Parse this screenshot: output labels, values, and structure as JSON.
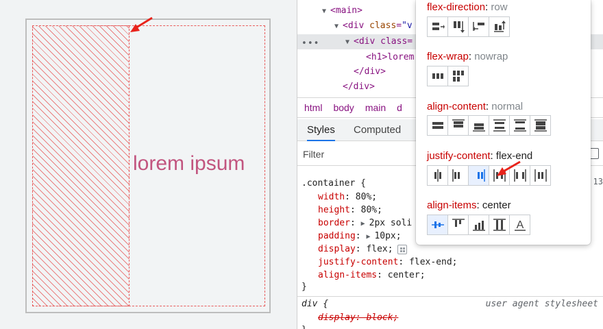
{
  "preview": {
    "h1_text": "lorem ipsum"
  },
  "devtools": {
    "dom_tree": {
      "main_tag": "main",
      "div_tag": "div",
      "div_class_attr": "class",
      "div_class_value_partial": "\"v",
      "selected_div_partial": "div class=",
      "h1_text": "h1>lorem",
      "close_div_1": "/div>",
      "close_div_2": "/div>"
    },
    "breadcrumbs": [
      "html",
      "body",
      "main",
      "d"
    ],
    "tabs": {
      "styles": "Styles",
      "computed": "Computed"
    },
    "filter": {
      "placeholder": "Filter"
    },
    "rules": {
      "container_selector": ".container {",
      "decls": [
        {
          "prop": "width",
          "value": "80%;"
        },
        {
          "prop": "height",
          "value": "80%;"
        },
        {
          "prop": "border",
          "value": "2px soli"
        },
        {
          "prop": "padding",
          "value": "10px;"
        },
        {
          "prop": "display",
          "value": "flex;"
        },
        {
          "prop": "justify-content",
          "value": "flex-end;"
        },
        {
          "prop": "align-items",
          "value": "center;"
        }
      ],
      "container_close": "}",
      "line_number_partial": "13",
      "div_selector": "div {",
      "ua_label": "user agent stylesheet",
      "div_display": "display: block;",
      "div_close": "}"
    }
  },
  "flex_editor": {
    "flex_direction": {
      "label": "flex-direction",
      "value": "row"
    },
    "flex_wrap": {
      "label": "flex-wrap",
      "value": "nowrap"
    },
    "align_content": {
      "label": "align-content",
      "value": "normal"
    },
    "justify_content": {
      "label": "justify-content",
      "value": "flex-end"
    },
    "align_items": {
      "label": "align-items",
      "value": "center"
    }
  },
  "colors": {
    "accent_blue": "#1a73e8",
    "property_red": "#c80000",
    "tag_purple": "#881280",
    "arrow_red": "#e8231b",
    "h1_pink": "#c2557f"
  }
}
